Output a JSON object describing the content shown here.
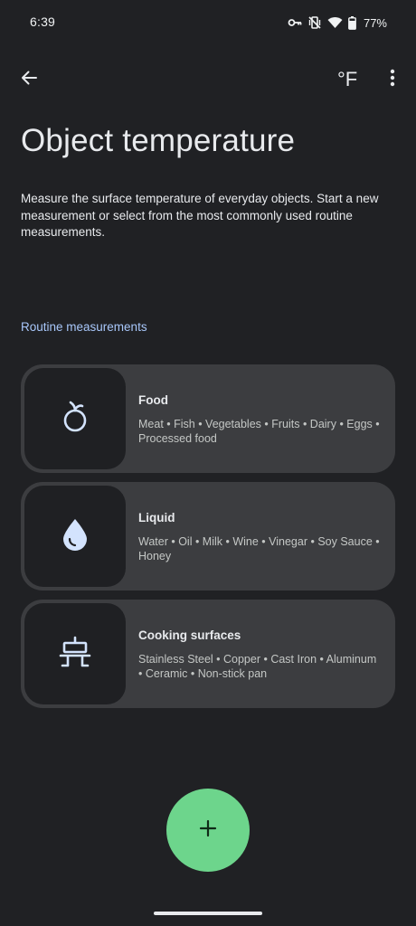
{
  "status_bar": {
    "time": "6:39",
    "battery": "77%",
    "icons": [
      "key-icon",
      "vibrate-off-icon",
      "wifi-icon",
      "battery-icon"
    ]
  },
  "app_bar": {
    "back_icon": "arrow-back-icon",
    "unit_label": "°F",
    "more_icon": "more-vert-icon"
  },
  "page": {
    "title": "Object temperature",
    "description": "Measure the surface temperature of everyday objects. Start a new measurement or select from the most commonly used routine measurements."
  },
  "routine": {
    "label": "Routine measurements",
    "items": [
      {
        "title": "Food",
        "description": "Meat • Fish • Vegetables • Fruits • Dairy • Eggs • Processed food",
        "icon": "apple-icon"
      },
      {
        "title": "Liquid",
        "description": "Water • Oil • Milk • Wine • Vinegar • Soy Sauce • Honey",
        "icon": "water-drop-icon"
      },
      {
        "title": "Cooking surfaces",
        "description": "Stainless Steel • Copper • Cast Iron • Aluminum • Ceramic • Non-stick pan",
        "icon": "cooktop-icon"
      }
    ]
  },
  "fab": {
    "icon": "plus-icon"
  },
  "colors": {
    "background": "#202124",
    "card": "#3c3d40",
    "card_icon_box": "#1f2023",
    "accent_link": "#a8c7fa",
    "fab": "#6dd58c"
  }
}
